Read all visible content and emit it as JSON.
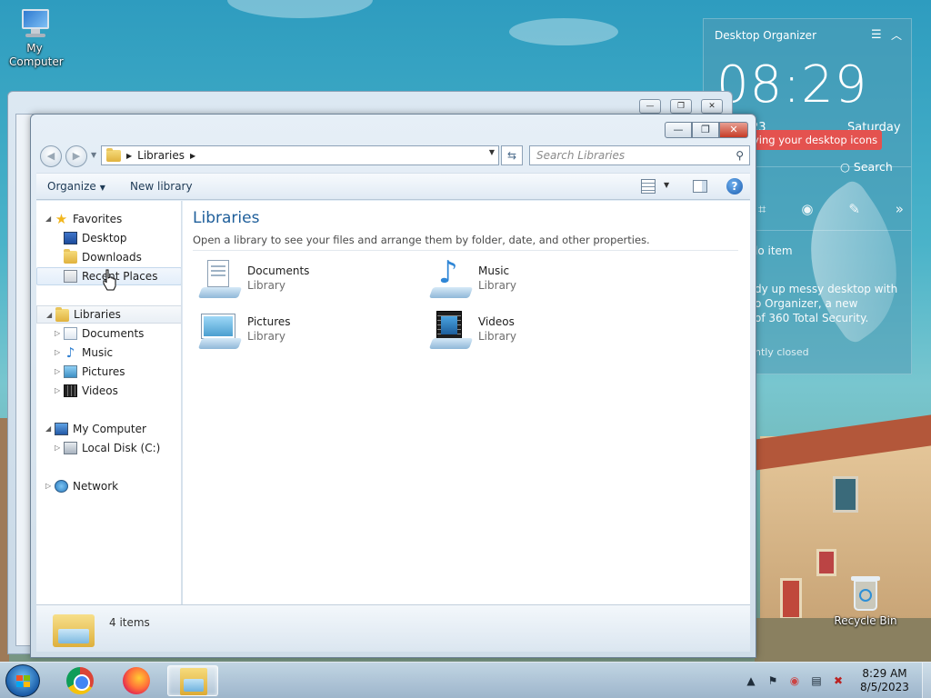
{
  "desktop": {
    "icons": {
      "my_computer": "My Computer",
      "recycle_bin": "Recycle Bin"
    }
  },
  "organizer": {
    "title": "Desktop Organizer",
    "menu_icon": "hamburger-icon",
    "collapse_icon": "chevron-up-icon",
    "time": "08:29",
    "date_partial": "23",
    "day": "Saturday",
    "pill_text": "ying your desktop icons",
    "search_label": "Search",
    "tools": [
      "crop-icon",
      "eye-icon",
      "edit-icon",
      "forward-icon"
    ],
    "add_item": "lo item",
    "body_lines": [
      "dy up messy desktop with",
      "o Organizer, a new",
      "of 360 Total Security."
    ],
    "note": "ntly closed"
  },
  "explorer": {
    "window_controls": {
      "minimize": "—",
      "maximize": "❐",
      "close": "✕"
    },
    "breadcrumb": [
      "Libraries"
    ],
    "search_placeholder": "Search Libraries",
    "commands": {
      "organize": "Organize",
      "new_library": "New library"
    },
    "nav": {
      "favorites": {
        "label": "Favorites",
        "items": [
          "Desktop",
          "Downloads",
          "Recent Places"
        ]
      },
      "libraries": {
        "label": "Libraries",
        "items": [
          "Documents",
          "Music",
          "Pictures",
          "Videos"
        ]
      },
      "computer": {
        "label": "My Computer",
        "items": [
          "Local Disk (C:)"
        ]
      },
      "network": {
        "label": "Network"
      }
    },
    "content": {
      "title": "Libraries",
      "description": "Open a library to see your files and arrange them by folder, date, and other properties.",
      "libraries": [
        {
          "name": "Documents",
          "type": "Library"
        },
        {
          "name": "Music",
          "type": "Library"
        },
        {
          "name": "Pictures",
          "type": "Library"
        },
        {
          "name": "Videos",
          "type": "Library"
        }
      ]
    },
    "details": {
      "count": "4 items"
    }
  },
  "taskbar": {
    "apps": [
      "Google Chrome",
      "Firefox",
      "Windows Explorer"
    ],
    "active_app": "Windows Explorer",
    "tray": {
      "time": "8:29 AM",
      "date": "8/5/2023"
    }
  },
  "colors": {
    "accent": "#1e5e9a",
    "pill": "#e4524f",
    "taskbar": "#b4c8dc"
  }
}
